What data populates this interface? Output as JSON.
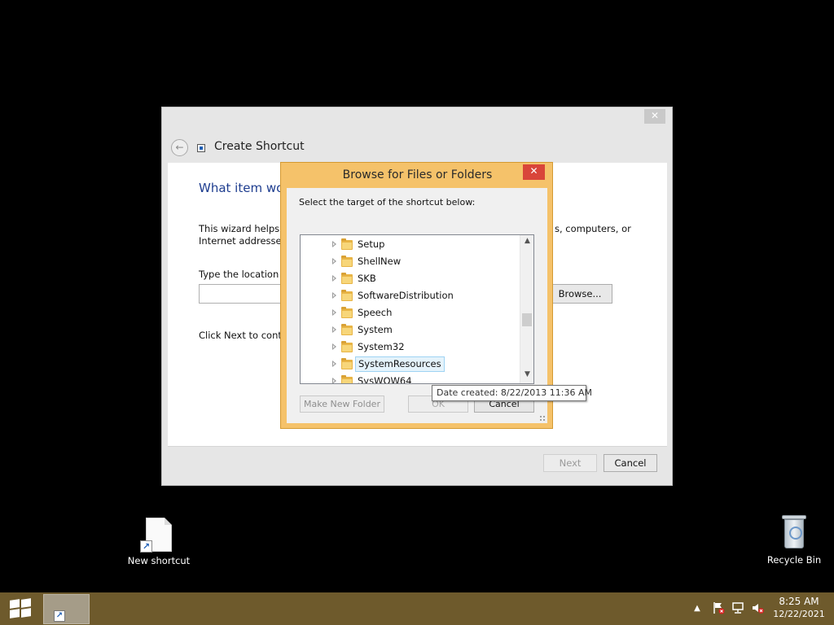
{
  "wizard": {
    "close_glyph": "✕",
    "back_glyph": "←",
    "title": "Create Shortcut",
    "heading": "What item wou",
    "desc_line1": "This wizard helps yo",
    "desc_line2": "Internet addresses.",
    "desc_right": "s, computers, or",
    "location_label": "Type the location o",
    "location_value": "",
    "browse_label": "Browse...",
    "next_hint": "Click Next to contin",
    "next_label": "Next",
    "cancel_label": "Cancel"
  },
  "browse_dialog": {
    "title": "Browse for Files or Folders",
    "close_glyph": "✕",
    "instruction": "Select the target of the shortcut below:",
    "tree_items": [
      {
        "label": "Setup",
        "selected": false
      },
      {
        "label": "ShellNew",
        "selected": false
      },
      {
        "label": "SKB",
        "selected": false
      },
      {
        "label": "SoftwareDistribution",
        "selected": false
      },
      {
        "label": "Speech",
        "selected": false
      },
      {
        "label": "System",
        "selected": false
      },
      {
        "label": "System32",
        "selected": false
      },
      {
        "label": "SystemResources",
        "selected": true
      },
      {
        "label": "SysWOW64",
        "selected": false
      }
    ],
    "new_folder_label": "Make New Folder",
    "ok_label": "OK",
    "cancel_label": "Cancel",
    "tooltip": "Date created: 8/22/2013 11:36 AM"
  },
  "desktop": {
    "icons": [
      {
        "label": "New shortcut",
        "icon": "shortcut-file-icon"
      },
      {
        "label": "Recycle Bin",
        "icon": "recycle-bin-icon"
      }
    ]
  },
  "taskbar": {
    "time": "8:25 AM",
    "date": "12/22/2021",
    "color": "#6e5a2c",
    "tray_icons": [
      "show-hidden-icons-icon",
      "action-center-flag-icon",
      "network-icon",
      "volume-muted-icon"
    ]
  },
  "colors": {
    "dialog_accent": "#f5c26a",
    "close_red": "#d9453a",
    "heading_blue": "#1e3d8f",
    "selection_bg": "#e5f3fb"
  }
}
